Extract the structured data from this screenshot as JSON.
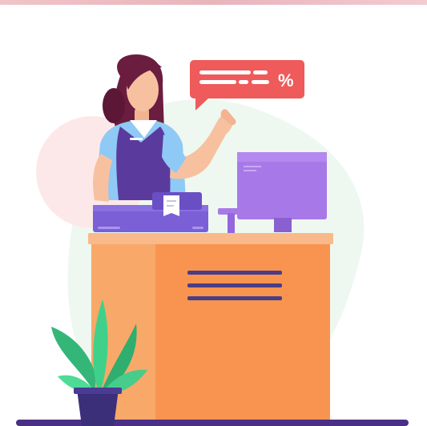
{
  "scene": {
    "subject": "cashier-at-checkout-counter",
    "speech_bubble": {
      "symbol": "%",
      "color": "#ef5a5a"
    },
    "colors": {
      "counter": "#f8944f",
      "counter_top": "#f9b98a",
      "register": "#7b5fd6",
      "monitor": "#a779e8",
      "uniform": "#5b3a9e",
      "shirt": "#8fc9f5",
      "hair": "#6b1d3f",
      "skin": "#f7c1a0",
      "plant": "#3fd18a",
      "pot": "#3c2f7a",
      "blob_green": "#eaf7ee",
      "blob_pink": "#fde6e7"
    },
    "icons": [
      "percent-icon",
      "cash-register-icon",
      "monitor-icon",
      "plant-icon"
    ]
  }
}
